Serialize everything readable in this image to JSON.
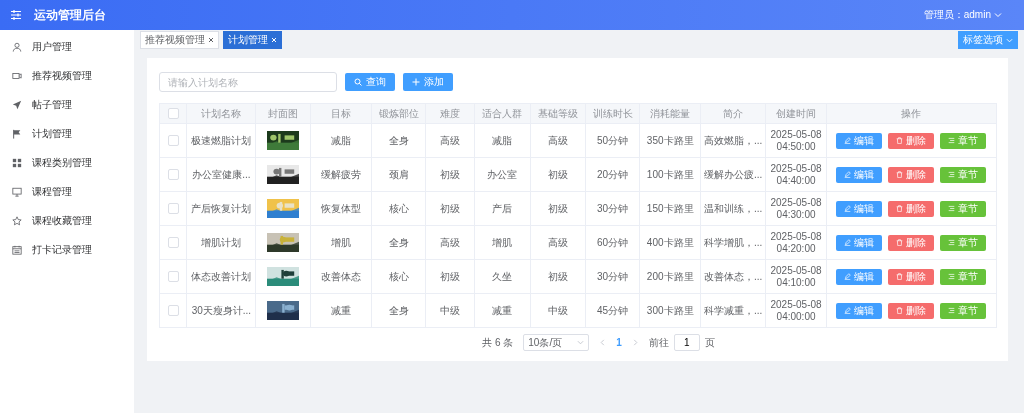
{
  "header": {
    "title": "运动管理后台",
    "admin_label": "管理员：admin"
  },
  "sidebar": {
    "items": [
      {
        "label": "用户管理",
        "selected": false
      },
      {
        "label": "推荐视频管理",
        "selected": false
      },
      {
        "label": "帖子管理",
        "selected": false
      },
      {
        "label": "计划管理",
        "selected": false
      },
      {
        "label": "课程类别管理",
        "selected": false
      },
      {
        "label": "课程管理",
        "selected": false
      },
      {
        "label": "课程收藏管理",
        "selected": false
      },
      {
        "label": "打卡记录管理",
        "selected": false
      }
    ]
  },
  "tabs": [
    {
      "label": "推荐视频管理",
      "selected": false
    },
    {
      "label": "计划管理",
      "selected": true
    }
  ],
  "tab_options_button": "标签选项",
  "search": {
    "placeholder": "请输入计划名称"
  },
  "buttons": {
    "query": "查询",
    "add": "添加"
  },
  "table": {
    "select_all_checked": false,
    "columns": [
      "计划名称",
      "封面图",
      "目标",
      "锻炼部位",
      "难度",
      "适合人群",
      "基础等级",
      "训练时长",
      "消耗能量",
      "简介",
      "创建时间",
      "操作"
    ],
    "rows": [
      {
        "checked": false,
        "name": "极速燃脂计划",
        "goal": "减脂",
        "body_part": "全身",
        "difficulty": "高级",
        "audience": "减脂",
        "level": "高级",
        "duration": "50分钟",
        "calories": "350卡路里",
        "intro": "高效燃脂，...",
        "created": "2025-05-08 04:50:00",
        "actions": [
          {
            "kind": "edit",
            "label": "编辑"
          },
          {
            "kind": "delete",
            "label": "删除"
          },
          {
            "kind": "chapter",
            "label": "章节"
          }
        ]
      },
      {
        "checked": false,
        "name": "办公室健康...",
        "goal": "缓解疲劳",
        "body_part": "颈肩",
        "difficulty": "初级",
        "audience": "办公室",
        "level": "初级",
        "duration": "20分钟",
        "calories": "100卡路里",
        "intro": "缓解办公疲...",
        "created": "2025-05-08 04:40:00",
        "actions": [
          {
            "kind": "edit",
            "label": "编辑"
          },
          {
            "kind": "delete",
            "label": "删除"
          },
          {
            "kind": "chapter",
            "label": "章节"
          }
        ]
      },
      {
        "checked": false,
        "name": "产后恢复计划",
        "goal": "恢复体型",
        "body_part": "核心",
        "difficulty": "初级",
        "audience": "产后",
        "level": "初级",
        "duration": "30分钟",
        "calories": "150卡路里",
        "intro": "温和训练，...",
        "created": "2025-05-08 04:30:00",
        "actions": [
          {
            "kind": "edit",
            "label": "编辑"
          },
          {
            "kind": "delete",
            "label": "删除"
          },
          {
            "kind": "chapter",
            "label": "章节"
          }
        ]
      },
      {
        "checked": false,
        "name": "增肌计划",
        "goal": "增肌",
        "body_part": "全身",
        "difficulty": "高级",
        "audience": "增肌",
        "level": "高级",
        "duration": "60分钟",
        "calories": "400卡路里",
        "intro": "科学增肌，...",
        "created": "2025-05-08 04:20:00",
        "actions": [
          {
            "kind": "edit",
            "label": "编辑"
          },
          {
            "kind": "delete",
            "label": "删除"
          },
          {
            "kind": "chapter",
            "label": "章节"
          }
        ]
      },
      {
        "checked": false,
        "name": "体态改善计划",
        "goal": "改善体态",
        "body_part": "核心",
        "difficulty": "初级",
        "audience": "久坐",
        "level": "初级",
        "duration": "30分钟",
        "calories": "200卡路里",
        "intro": "改善体态，...",
        "created": "2025-05-08 04:10:00",
        "actions": [
          {
            "kind": "edit",
            "label": "编辑"
          },
          {
            "kind": "delete",
            "label": "删除"
          },
          {
            "kind": "chapter",
            "label": "章节"
          }
        ]
      },
      {
        "checked": false,
        "name": "30天瘦身计...",
        "goal": "减重",
        "body_part": "全身",
        "difficulty": "中级",
        "audience": "减重",
        "level": "中级",
        "duration": "45分钟",
        "calories": "300卡路里",
        "intro": "科学减重，...",
        "created": "2025-05-08 04:00:00",
        "actions": [
          {
            "kind": "edit",
            "label": "编辑"
          },
          {
            "kind": "delete",
            "label": "删除"
          },
          {
            "kind": "chapter",
            "label": "章节"
          }
        ]
      }
    ]
  },
  "pagination": {
    "total": "共 6 条",
    "page_size": "10条/页",
    "pages": [
      {
        "label": "1",
        "selected": true
      }
    ],
    "goto_label": "前往",
    "goto_value": "1",
    "goto_suffix": "页"
  }
}
